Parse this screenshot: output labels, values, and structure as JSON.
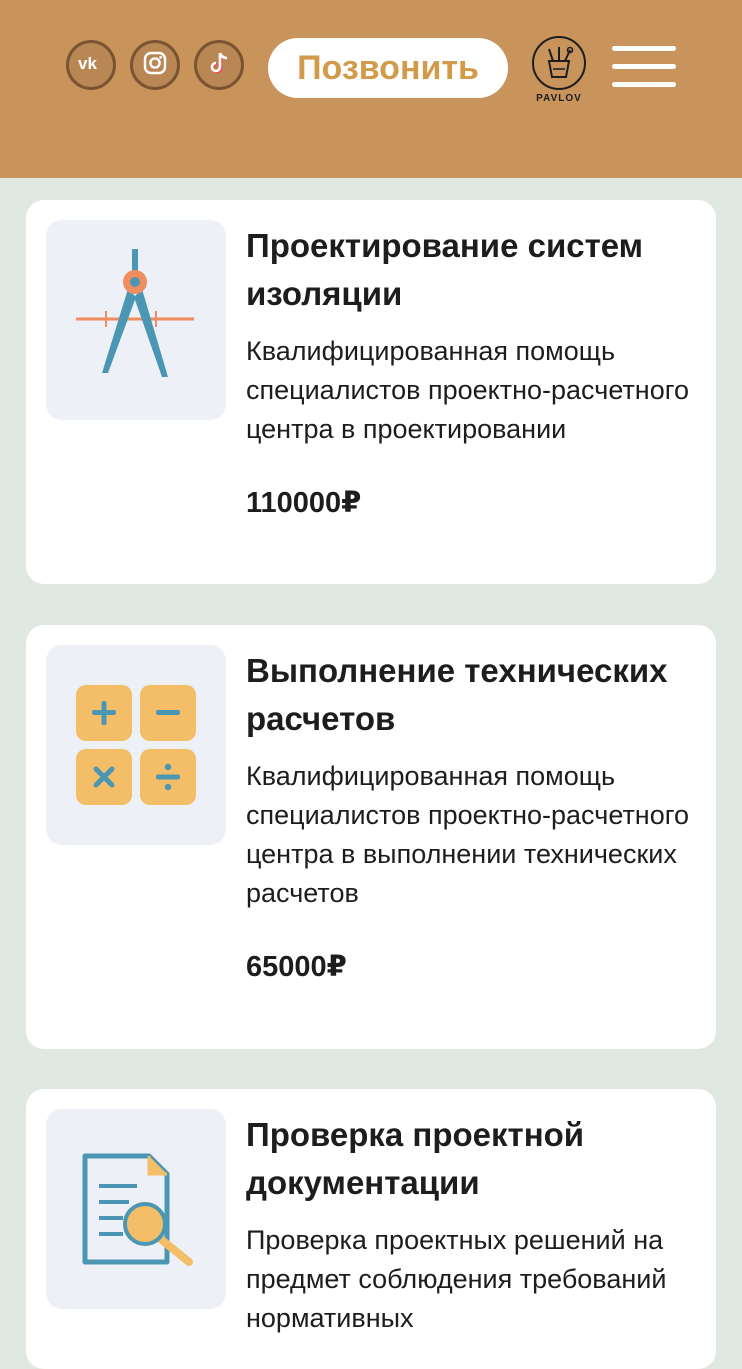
{
  "header": {
    "social": [
      {
        "icon": "vk-icon",
        "label": "VK"
      },
      {
        "icon": "instagram-icon",
        "label": "Instagram"
      },
      {
        "icon": "tiktok-icon",
        "label": "TikTok"
      }
    ],
    "call_label": "Позвонить",
    "logo_text": "PAVLOV",
    "colors": {
      "header_bg": "#c9945b",
      "accent": "#d29a4b",
      "page_bg": "#dfe8e1"
    }
  },
  "services": [
    {
      "icon": "compass-icon",
      "title": "Проектирование систем изоляции",
      "description": "Квалифицированная помощь специалистов проектно-расчетного центра в проектировании",
      "price": "110000₽"
    },
    {
      "icon": "calculator-icon",
      "title": "Выполнение технических расчетов",
      "description": "Квалифицированная помощь специалистов проектно-расчетного центра в выполнении технических расчетов",
      "price": "65000₽"
    },
    {
      "icon": "document-search-icon",
      "title": "Проверка проектной документации",
      "description": "Проверка проектных решений на предмет соблюдения требований нормативных"
    }
  ]
}
